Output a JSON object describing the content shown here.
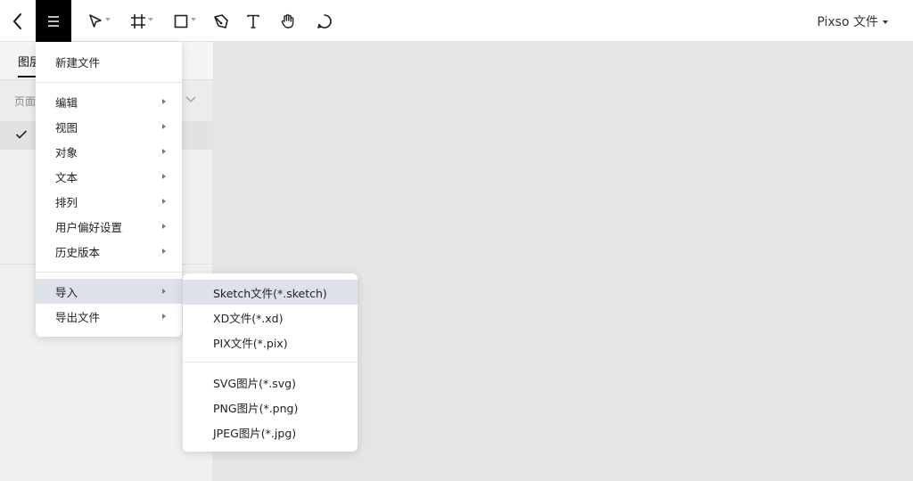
{
  "toolbar": {
    "file_title": "Pixso 文件",
    "tools": [
      "back-icon",
      "menu-icon",
      "move-icon",
      "frame-icon",
      "rectangle-icon",
      "pen-icon",
      "text-icon",
      "hand-icon",
      "comment-icon"
    ]
  },
  "left_panel": {
    "tab_label": "图层",
    "pages_label": "页面"
  },
  "menu": {
    "items": [
      {
        "label": "新建文件",
        "has_submenu": false
      },
      {
        "label": "编辑",
        "has_submenu": true
      },
      {
        "label": "视图",
        "has_submenu": true
      },
      {
        "label": "对象",
        "has_submenu": true
      },
      {
        "label": "文本",
        "has_submenu": true
      },
      {
        "label": "排列",
        "has_submenu": true
      },
      {
        "label": "用户偏好设置",
        "has_submenu": true
      },
      {
        "label": "历史版本",
        "has_submenu": true
      },
      {
        "label": "导入",
        "has_submenu": true,
        "active": true
      },
      {
        "label": "导出文件",
        "has_submenu": true
      }
    ]
  },
  "submenu": {
    "items": [
      {
        "label": "Sketch文件(*.sketch)",
        "active": true
      },
      {
        "label": "XD文件(*.xd)"
      },
      {
        "label": "PIX文件(*.pix)"
      },
      {
        "label": "SVG图片(*.svg)"
      },
      {
        "label": "PNG图片(*.png)"
      },
      {
        "label": "JPEG图片(*.jpg)"
      }
    ]
  },
  "colors": {
    "toolbar_bg": "#ffffff",
    "canvas_bg": "#e5e5e5",
    "menu_active_bg": "#dde1ea",
    "menu_button_bg": "#000000"
  }
}
